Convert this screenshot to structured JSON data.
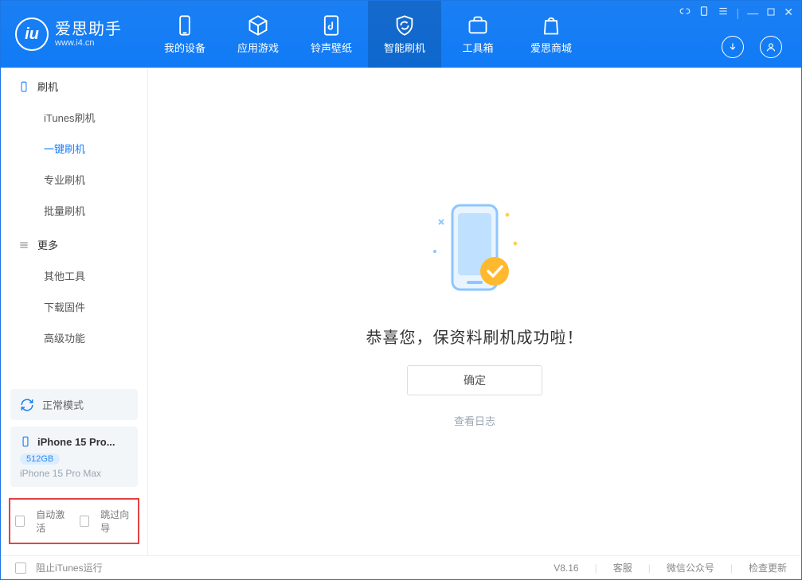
{
  "app": {
    "title": "爱思助手",
    "subtitle": "www.i4.cn"
  },
  "nav": {
    "mydevice": "我的设备",
    "apps": "应用游戏",
    "ringtone": "铃声壁纸",
    "flash": "智能刷机",
    "toolbox": "工具箱",
    "store": "爱思商城"
  },
  "sidebar": {
    "section_flash": "刷机",
    "items_flash": {
      "itunes": "iTunes刷机",
      "oneclick": "一键刷机",
      "pro": "专业刷机",
      "batch": "批量刷机"
    },
    "section_more": "更多",
    "items_more": {
      "other": "其他工具",
      "firmware": "下载固件",
      "advanced": "高级功能"
    }
  },
  "device_mode": "正常模式",
  "device": {
    "name": "iPhone 15 Pro...",
    "storage": "512GB",
    "model": "iPhone 15 Pro Max"
  },
  "options": {
    "auto_activate": "自动激活",
    "skip_guide": "跳过向导"
  },
  "main": {
    "success_title": "恭喜您，保资料刷机成功啦！",
    "ok": "确定",
    "view_log": "查看日志"
  },
  "footer": {
    "block_itunes": "阻止iTunes运行",
    "version": "V8.16",
    "support": "客服",
    "wechat": "微信公众号",
    "update": "检查更新"
  }
}
